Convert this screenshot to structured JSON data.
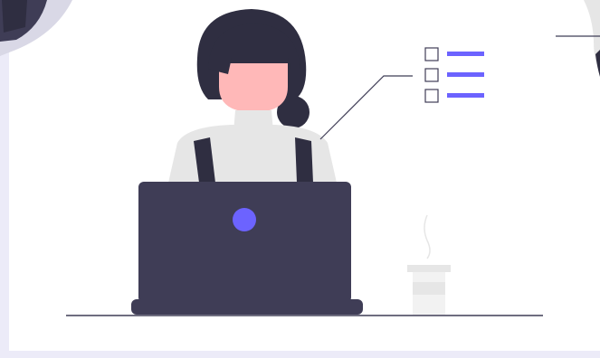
{
  "illustration": {
    "subject": "woman-at-laptop",
    "icons": [
      "checklist-icon",
      "coffee-cup-icon",
      "laptop-icon",
      "person-icon"
    ],
    "colors": {
      "page_background": "#ecebf8",
      "card_background": "#ffffff",
      "laptop": "#3f3d56",
      "hair": "#2f2e41",
      "skin": "#ffb8b8",
      "sweater": "#e6e6e6",
      "accent": "#6c63ff",
      "cup": "#f2f2f2",
      "line": "#3f3d56"
    },
    "checklist": {
      "rows": 3,
      "checked": 0
    }
  }
}
